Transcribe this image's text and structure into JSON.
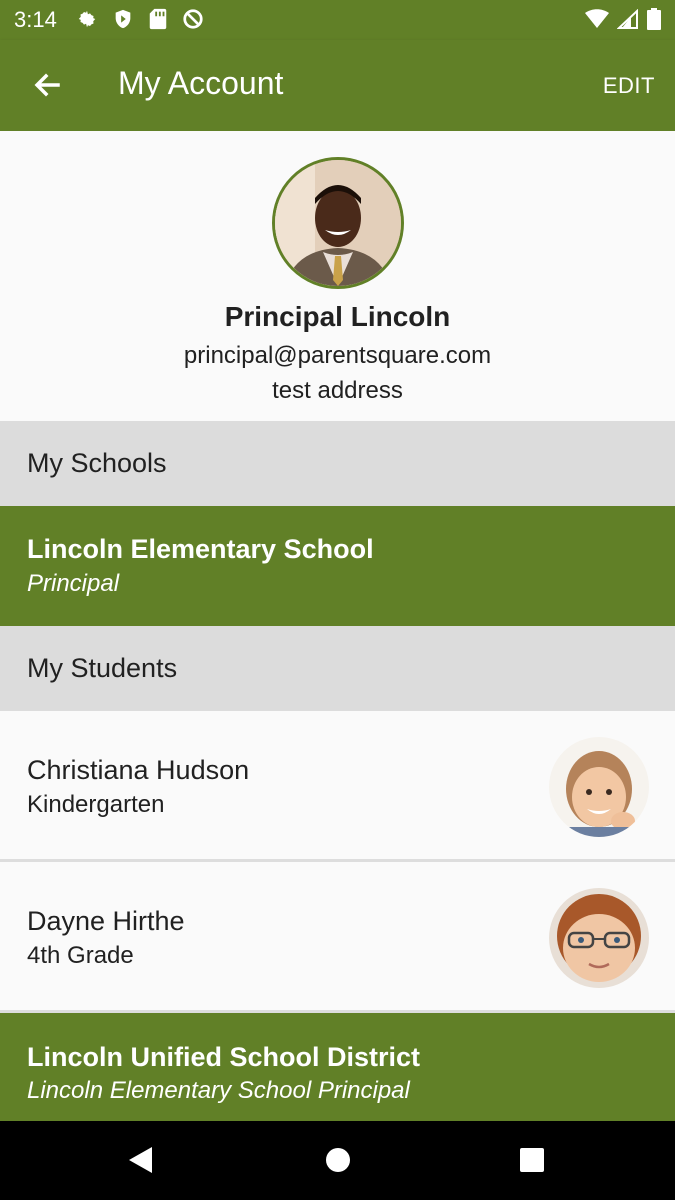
{
  "status": {
    "time": "3:14",
    "left_icons": [
      "gear-icon",
      "shield-icon",
      "sd-card-icon",
      "no-sync-icon"
    ],
    "right_icons": [
      "wifi-icon",
      "signal-icon",
      "battery-icon"
    ]
  },
  "appbar": {
    "title": "My Account",
    "edit_label": "EDIT",
    "back_icon": "arrow-left-icon",
    "color": "#618027"
  },
  "profile": {
    "name": "Principal Lincoln",
    "email": "principal@parentsquare.com",
    "address": "test address",
    "avatar": "principal-photo"
  },
  "sections": {
    "schools_header": "My Schools",
    "students_header": "My Students"
  },
  "schools": [
    {
      "name": "Lincoln Elementary School",
      "role": "Principal"
    }
  ],
  "students": [
    {
      "name": "Christiana Hudson",
      "grade": "Kindergarten",
      "avatar": "girl-photo"
    },
    {
      "name": "Dayne Hirthe",
      "grade": "4th Grade",
      "avatar": "boy-glasses-photo"
    }
  ],
  "district": {
    "name": "Lincoln Unified School District",
    "role": "Lincoln Elementary School Principal"
  },
  "navbar": {
    "buttons": [
      "back-triangle-icon",
      "home-circle-icon",
      "recents-square-icon"
    ]
  }
}
